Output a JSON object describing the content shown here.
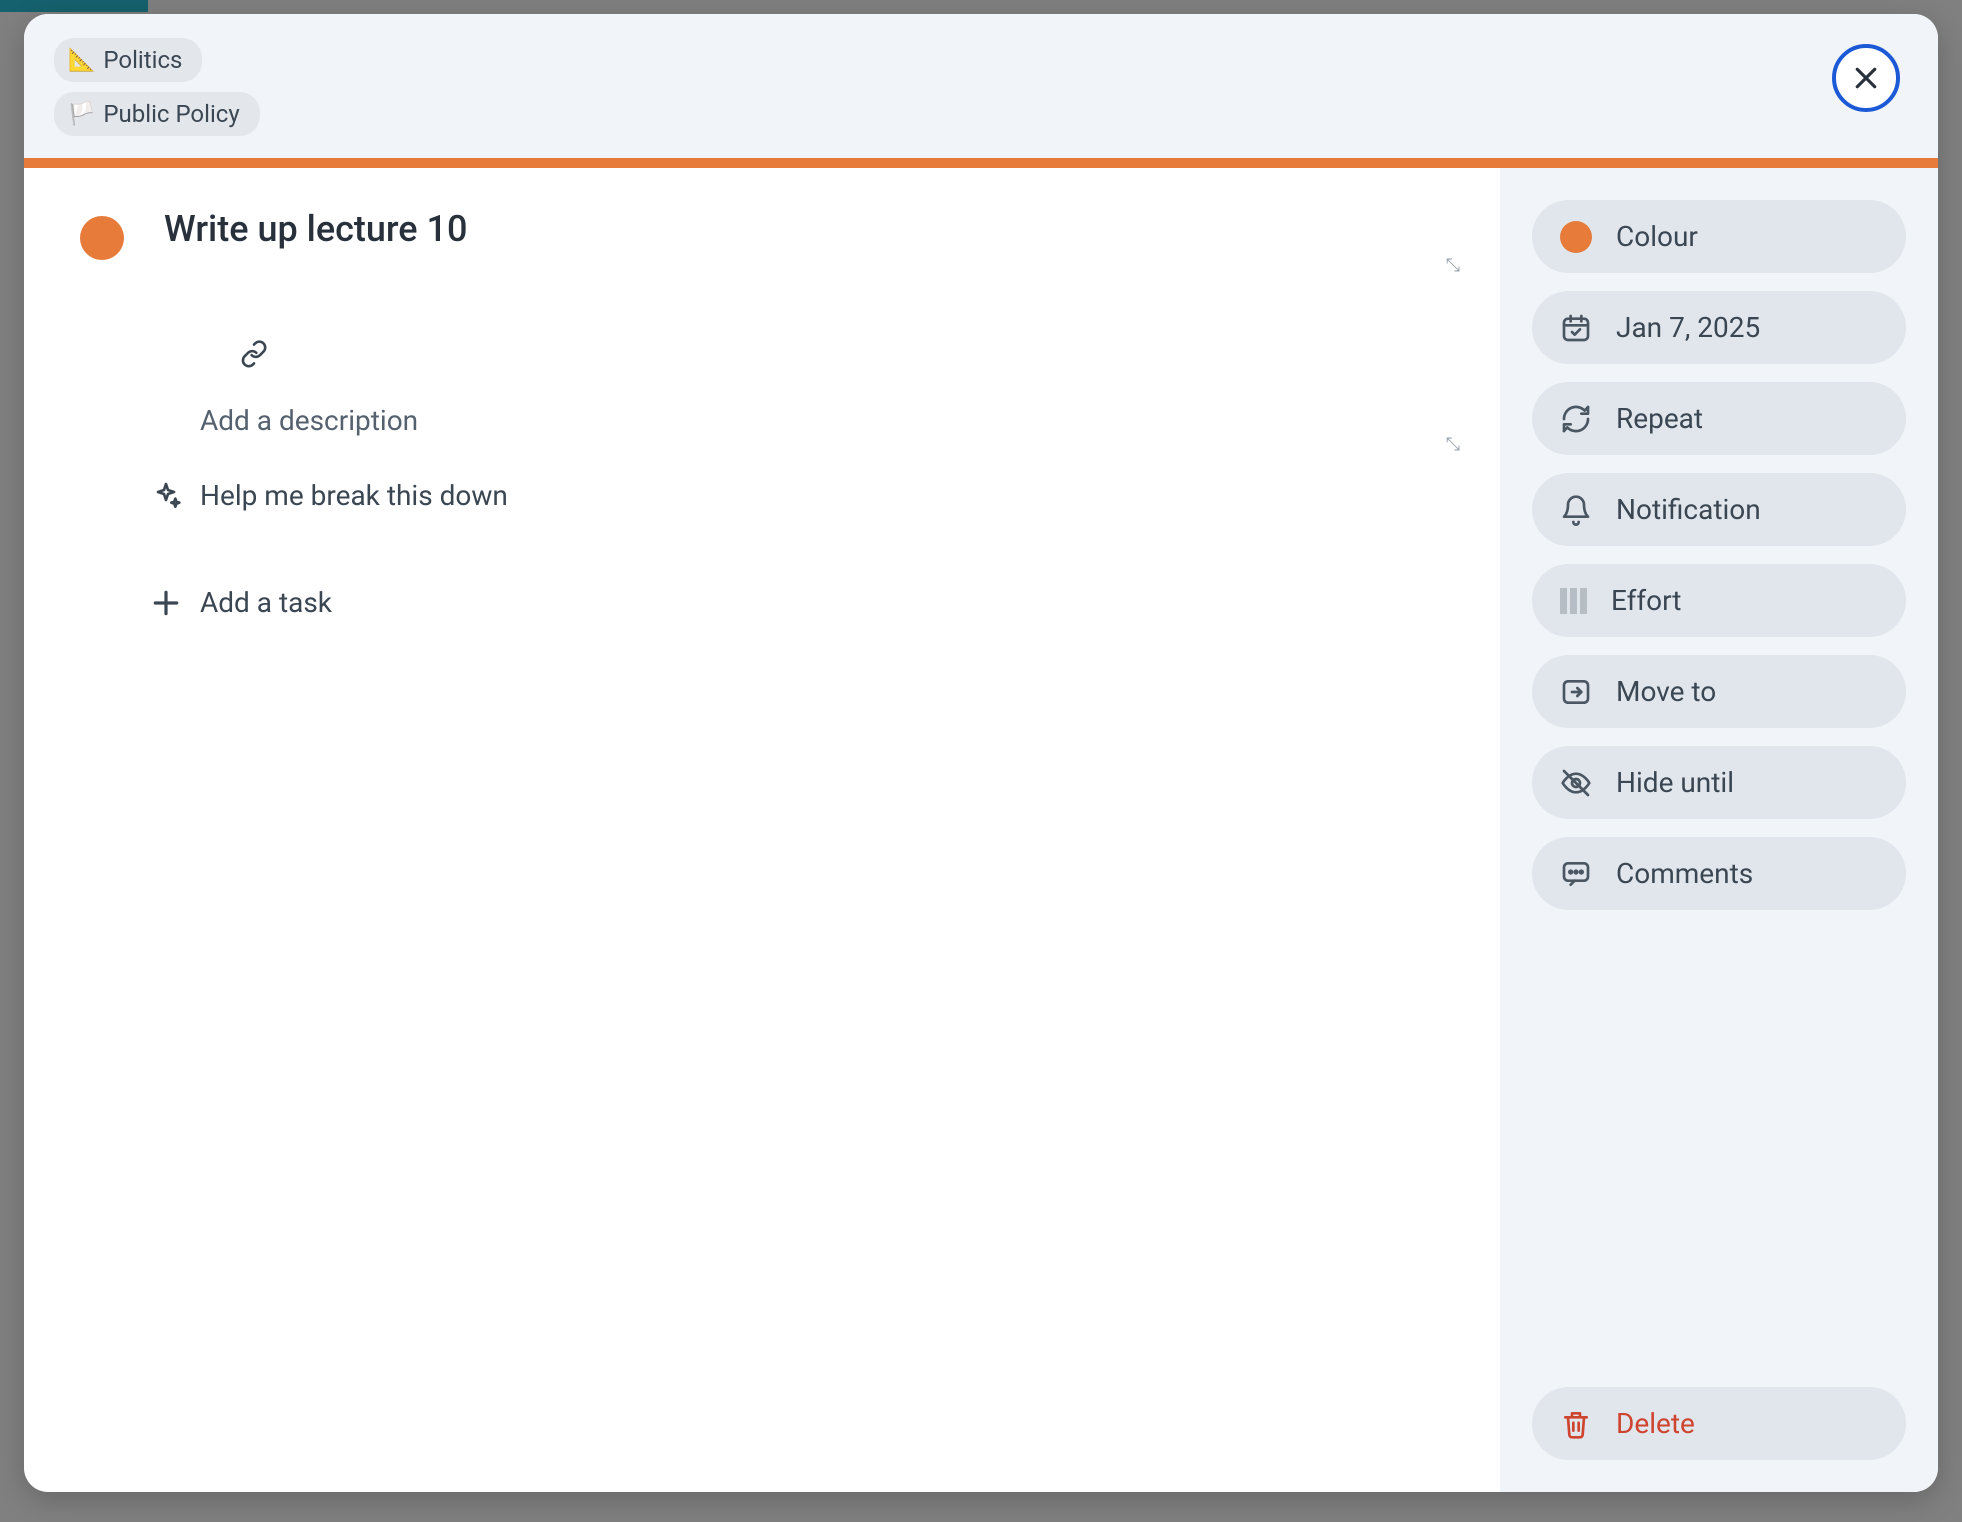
{
  "breadcrumbs": {
    "parent": {
      "emoji": "📐",
      "label": "Politics"
    },
    "child": {
      "emoji": "🏳️",
      "label": "Public Policy"
    }
  },
  "task": {
    "title": "Write up lecture 10",
    "description": "",
    "description_placeholder": "Add a description",
    "color": "#e77b3a"
  },
  "actions": {
    "break_down": "Help me break this down",
    "add_task": "Add a task"
  },
  "sidebar": {
    "colour": "Colour",
    "date": "Jan 7, 2025",
    "repeat": "Repeat",
    "notification": "Notification",
    "effort": "Effort",
    "move_to": "Move to",
    "hide_until": "Hide until",
    "comments": "Comments",
    "delete": "Delete"
  }
}
